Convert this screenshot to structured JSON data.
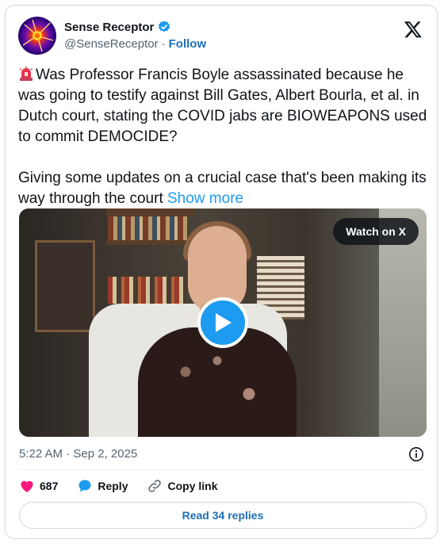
{
  "author": {
    "name": "Sense Receptor",
    "handle": "@SenseReceptor",
    "separator": "·",
    "follow_label": "Follow",
    "verified": true,
    "avatar_icon": "neuron-avatar"
  },
  "tweet": {
    "paragraph1": "Was Professor Francis Boyle assassinated because he was going to testify against Bill Gates, Albert Bourla, et al. in Dutch court, stating the COVID jabs are BIOWEAPONS used to commit DEMOCIDE?",
    "paragraph2": "Giving some updates on a crucial case that's been making its way through the court",
    "show_more_label": "Show more",
    "emoji_icon": "police-siren-emoji"
  },
  "media": {
    "watch_label": "Watch on X",
    "play_icon": "play-icon"
  },
  "timestamp": "5:22 AM · Sep 2, 2025",
  "actions": {
    "likes_count": "687",
    "reply_label": "Reply",
    "copy_link_label": "Copy link"
  },
  "read_replies_label": "Read 34 replies",
  "colors": {
    "accent": "#1d9bf0",
    "link": "#1d6fb8",
    "like": "#f91880",
    "muted": "#536471"
  }
}
